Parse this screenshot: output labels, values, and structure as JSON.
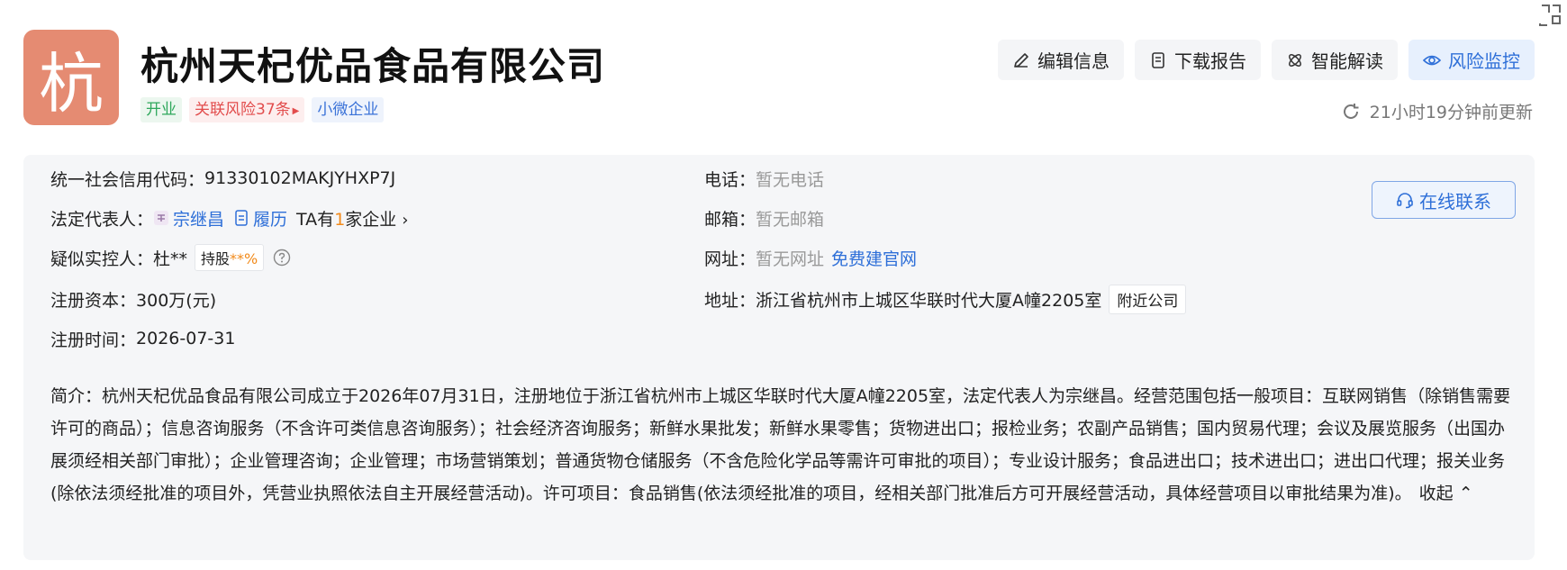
{
  "company": {
    "logo_char": "杭",
    "name": "杭州天杞优品食品有限公司",
    "tags": {
      "status": "开业",
      "risk": "关联风险37条",
      "type": "小微企业"
    }
  },
  "actions": {
    "edit": "编辑信息",
    "download": "下载报告",
    "ai": "智能解读",
    "monitor": "风险监控"
  },
  "update_text": "21小时19分钟前更新",
  "info": {
    "credit_code_label": "统一社会信用代码：",
    "credit_code": "91330102MAKJYHXP7J",
    "legal_rep_label": "法定代表人：",
    "legal_rep": "宗继昌",
    "resume": "履历",
    "ta_prefix": "TA有",
    "ta_count": "1",
    "ta_suffix": "家企业",
    "controller_label": "疑似实控人：",
    "controller": "杜**",
    "hold_label": "持股",
    "hold_value": "**%",
    "capital_label": "注册资本：",
    "capital": "300万(元)",
    "reg_time_label": "注册时间：",
    "reg_time": "2026-07-31",
    "phone_label": "电话：",
    "phone": "暂无电话",
    "email_label": "邮箱：",
    "email": "暂无邮箱",
    "website_label": "网址：",
    "website": "暂无网址",
    "website_link": "免费建官网",
    "address_label": "地址：",
    "address": "浙江省杭州市上城区华联时代大厦A幢2205室",
    "nearby": "附近公司",
    "online_contact": "在线联系"
  },
  "intro": {
    "text": "简介：杭州天杞优品食品有限公司成立于2026年07月31日，注册地位于浙江省杭州市上城区华联时代大厦A幢2205室，法定代表人为宗继昌。经营范围包括一般项目：互联网销售（除销售需要许可的商品）；信息咨询服务（不含许可类信息咨询服务）；社会经济咨询服务；新鲜水果批发；新鲜水果零售；货物进出口；报检业务；农副产品销售；国内贸易代理；会议及展览服务（出国办展须经相关部门审批）；企业管理咨询；企业管理；市场营销策划；普通货物仓储服务（不含危险化学品等需许可审批的项目）；专业设计服务；食品进出口；技术进出口；进出口代理；报关业务(除依法须经批准的项目外，凭营业执照依法自主开展经营活动)。许可项目：食品销售(依法须经批准的项目，经相关部门批准后方可开展经营活动，具体经营项目以审批结果为准)。",
    "collapse": "收起"
  }
}
